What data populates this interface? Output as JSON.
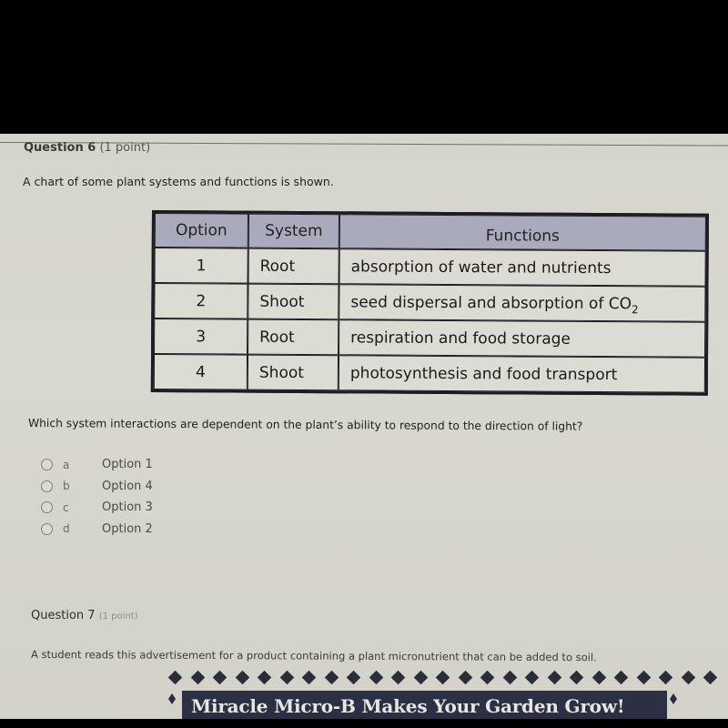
{
  "question6": {
    "title": "Question 6",
    "points": "(1 point)",
    "prompt": "A chart of some plant systems and functions is shown.",
    "table": {
      "headers": [
        "Option",
        "System",
        "Functions"
      ],
      "rows": [
        {
          "option": "1",
          "system": "Root",
          "functions": "absorption of water and nutrients",
          "subscript": ""
        },
        {
          "option": "2",
          "system": "Shoot",
          "functions": "seed dispersal and absorption of CO",
          "subscript": "2"
        },
        {
          "option": "3",
          "system": "Root",
          "functions": "respiration and food storage",
          "subscript": ""
        },
        {
          "option": "4",
          "system": "Shoot",
          "functions": "photosynthesis and food transport",
          "subscript": ""
        }
      ]
    },
    "question": "Which system interactions are dependent on the plant’s ability to respond to the direction of light?",
    "choices": [
      {
        "letter": "a",
        "text": "Option 1",
        "selected": false
      },
      {
        "letter": "b",
        "text": "Option 4",
        "selected": false
      },
      {
        "letter": "c",
        "text": "Option 3",
        "selected": false
      },
      {
        "letter": "d",
        "text": "Option 2",
        "selected": false
      }
    ]
  },
  "question7": {
    "title": "Question 7",
    "points": "(1 point)",
    "prompt": "A student reads this advertisement for a product containing a plant micronutrient that can be added to soil.",
    "advertisement": {
      "headline": "Miracle Micro-B Makes Your Garden Grow!"
    }
  },
  "colors": {
    "table_header": "#a9aabb",
    "table_border": "#1c1c22",
    "ad_banner": "#2d2f44",
    "page_background": "#d6d5cd"
  }
}
